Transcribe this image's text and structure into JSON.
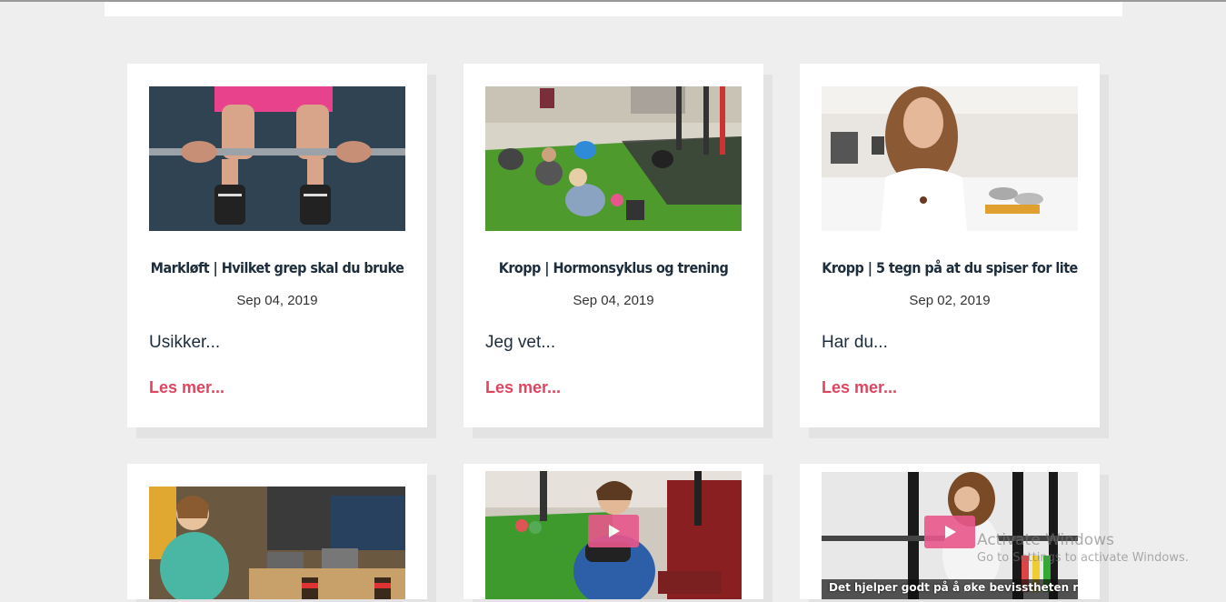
{
  "posts": [
    {
      "title": "Markløft | Hvilket grep skal du bruke",
      "date": "Sep 04, 2019",
      "excerpt": "Usikker...",
      "more": "Les mer..."
    },
    {
      "title": "Kropp | Hormonsyklus og trening",
      "date": "Sep 04, 2019",
      "excerpt": "Jeg vet...",
      "more": "Les mer..."
    },
    {
      "title": "Kropp | 5 tegn på at du spiser for lite",
      "date": "Sep 02, 2019",
      "excerpt": "Har du...",
      "more": "Les mer..."
    }
  ],
  "row2": {
    "video3_subtitle": "Det hjelper godt på å øke bevisstheten rundt"
  },
  "watermark": {
    "line1": "Activate Windows",
    "line2": "Go to Settings to activate Windows."
  },
  "colors": {
    "accent": "#e04560",
    "title": "#1d2d3c",
    "background": "#eeeeee"
  }
}
